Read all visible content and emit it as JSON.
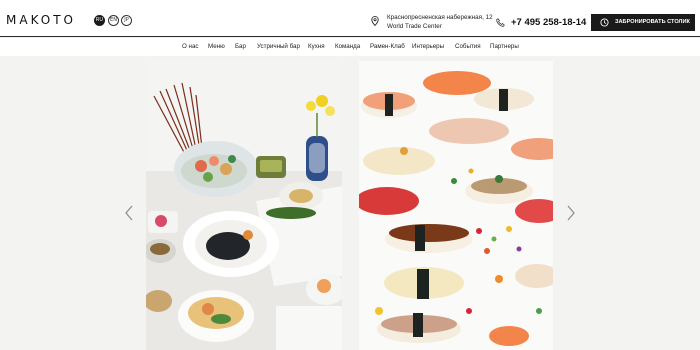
{
  "brand": {
    "logo_text": "MAKOTO"
  },
  "languages": [
    {
      "code": "RU",
      "active": true
    },
    {
      "code": "EN",
      "active": false
    },
    {
      "code": "JP",
      "active": false
    }
  ],
  "contact": {
    "address_line1": "Краснопресненская набережная, 12",
    "address_line2": "World Trade Center",
    "phone": "+7 495 258-18-14"
  },
  "cta": {
    "book_label": "ЗАБРОНИРОВАТЬ СТОЛИК"
  },
  "nav": {
    "items": [
      "О нас",
      "Меню",
      "Бар",
      "Устричный бар",
      "Кухня",
      "Команда",
      "Рамен-Клаб",
      "Интерьеры",
      "События",
      "Партнеры"
    ]
  },
  "slider": {
    "slides": [
      {
        "icon": "food-platter-photo"
      },
      {
        "icon": "sushi-nigiri-photo"
      }
    ]
  },
  "colors": {
    "header_bg": "#ffffff",
    "button_bg": "#1a1a1a",
    "page_bg": "#f3f3f1"
  }
}
